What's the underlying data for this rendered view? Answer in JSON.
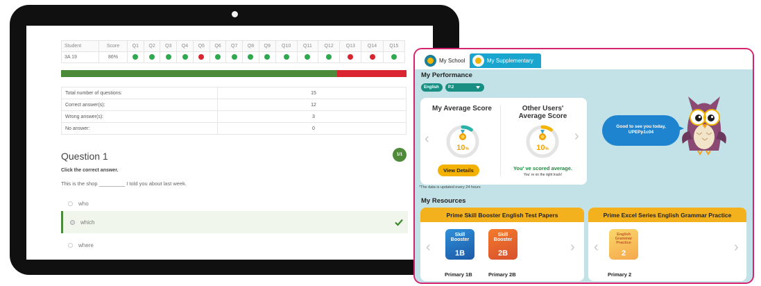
{
  "tablet": {
    "table": {
      "headers": [
        "Student",
        "Score",
        "Q1",
        "Q2",
        "Q3",
        "Q4",
        "Q5",
        "Q6",
        "Q7",
        "Q8",
        "Q9",
        "Q10",
        "Q11",
        "Q12",
        "Q13",
        "Q14",
        "Q15"
      ],
      "student": "3A 19",
      "score": "86%",
      "answers": [
        "correct",
        "correct",
        "correct",
        "correct",
        "wrong",
        "correct",
        "correct",
        "correct",
        "correct",
        "correct",
        "correct",
        "correct",
        "wrong",
        "wrong",
        "correct"
      ]
    },
    "result_bar": {
      "correct_fraction": 0.8,
      "colors": {
        "correct": "#4a8a38",
        "wrong": "#d9252f"
      }
    },
    "summary": [
      {
        "label": "Total number of questions:",
        "value": "15"
      },
      {
        "label": "Correct answer(s):",
        "value": "12"
      },
      {
        "label": "Wrong answer(s):",
        "value": "3"
      },
      {
        "label": "No answer:",
        "value": "0"
      }
    ],
    "question": {
      "title": "Question 1",
      "badge": "1/1",
      "instruction": "Click the correct answer.",
      "text": "This is the shop _________ I told you about last week.",
      "options": [
        {
          "label": "who",
          "selected": false
        },
        {
          "label": "which",
          "selected": true,
          "correct": true
        },
        {
          "label": "where",
          "selected": false
        }
      ]
    }
  },
  "app": {
    "tabs": {
      "school": "My School",
      "supplementary": "My Supplementary"
    },
    "performance": {
      "heading": "My Performance",
      "subject": "English",
      "grade": "P.2",
      "my_score": {
        "title": "My Average Score",
        "value": 10,
        "unit": "%"
      },
      "others_score": {
        "title_line1": "Other Users'",
        "title_line2": "Average Score",
        "value": 10,
        "unit": "%"
      },
      "view_details": "View Details",
      "average_msg": "You'  ve scored average.",
      "track_msg": "You'  re on the right track!",
      "note": "*The data is updated every 24 hours"
    },
    "greeting": {
      "line1": "Good to see you today,",
      "line2": "UPEPp1c04"
    },
    "resources": {
      "heading": "My Resources",
      "card_a": {
        "title": "Prime Skill Booster English Test Papers",
        "books": [
          {
            "cover_title": "Skill Booster",
            "cover_num": "1B",
            "label": "Primary 1B"
          },
          {
            "cover_title": "Skill Booster",
            "cover_num": "2B",
            "label": "Primary 2B"
          }
        ]
      },
      "card_b": {
        "title": "Prime Excel Series English Grammar Practice",
        "books": [
          {
            "cover_title": "English Grammar Practice",
            "cover_num": "2",
            "label": "Primary 2"
          }
        ]
      }
    },
    "colors": {
      "border": "#d8216e",
      "background": "#c2e2e8",
      "accent": "#f3b21d",
      "tab_active": "#1aa5cf"
    }
  }
}
